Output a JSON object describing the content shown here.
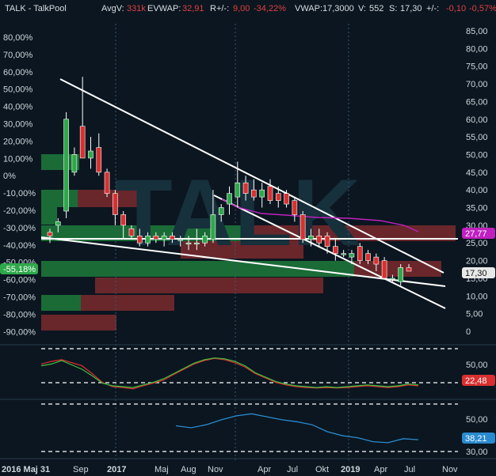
{
  "header": {
    "ticker": "TALK - TalkPool",
    "avgv_label": "AvgV:",
    "avgv_value": "331k",
    "evwap_label": "EVWAP:",
    "evwap_value": "32,91",
    "rplus_label": "R+/-:",
    "rplus_value": "9,00",
    "rpct_value": "-34,22%",
    "vwap_label": "VWAP:",
    "vwap_value": "17,3000",
    "v_label": "V:",
    "v_value": "552",
    "s_label": "S:",
    "s_value": "17,30",
    "pm_label": "+/-:",
    "pm_value": "-0,10",
    "pm_pct": "-0,57%"
  },
  "colors": {
    "background": "#0b1620",
    "up_candle": "#2ea84a",
    "down_candle": "#d83030",
    "zone_green": "#1f7a3c",
    "zone_red": "#7a2a2e",
    "trendline": "#ffffff",
    "ma": "#c020c0",
    "osc_red": "#e03030",
    "osc_green": "#40c040",
    "osc_blue": "#2a8ad0"
  },
  "chart_data": {
    "type": "candlestick",
    "watermark": "TALK",
    "y_right_ticks": [
      "85,00",
      "80,00",
      "75,00",
      "70,00",
      "65,00",
      "60,00",
      "55,00",
      "50,00",
      "45,00",
      "40,00",
      "35,00",
      "30,00",
      "25,00",
      "20,00",
      "15,00",
      "10,00",
      "5,00",
      "0"
    ],
    "y_left_ticks": [
      "80,00%",
      "70,00%",
      "60,00%",
      "50,00%",
      "40,00%",
      "30,00%",
      "20,00%",
      "10,00%",
      "0%",
      "-10,00%",
      "-20,00%",
      "-30,00%",
      "-40,00%",
      "-50,00%",
      "-60,00%",
      "-70,00%",
      "-80,00%",
      "-90,00%"
    ],
    "x_labels": [
      "2016 Maj 31",
      "Sep",
      "2017",
      "Maj",
      "Aug",
      "Nov",
      "Apr",
      "Jul",
      "Okt",
      "2019",
      "Apr",
      "Jul",
      "Nov"
    ],
    "price_tag": "17,30",
    "ma_tag": "27,77",
    "pct_tag": "-55,18%",
    "candles": [
      {
        "o": 28,
        "h": 29,
        "l": 25,
        "c": 27
      },
      {
        "o": 30,
        "h": 32,
        "l": 28,
        "c": 31
      },
      {
        "o": 34,
        "h": 62,
        "l": 32,
        "c": 60
      },
      {
        "o": 45,
        "h": 52,
        "l": 44,
        "c": 50
      },
      {
        "o": 58,
        "h": 72,
        "l": 49,
        "c": 49
      },
      {
        "o": 49,
        "h": 55,
        "l": 46,
        "c": 51
      },
      {
        "o": 52,
        "h": 56,
        "l": 44,
        "c": 45
      },
      {
        "o": 45,
        "h": 46,
        "l": 38,
        "c": 39
      },
      {
        "o": 39,
        "h": 40,
        "l": 30,
        "c": 33
      },
      {
        "o": 33,
        "h": 34,
        "l": 26,
        "c": 30
      },
      {
        "o": 29,
        "h": 30,
        "l": 26,
        "c": 27
      },
      {
        "o": 27,
        "h": 29,
        "l": 24,
        "c": 25
      },
      {
        "o": 25,
        "h": 28,
        "l": 24,
        "c": 27
      },
      {
        "o": 27,
        "h": 28,
        "l": 25,
        "c": 26
      },
      {
        "o": 26,
        "h": 28,
        "l": 24,
        "c": 27
      },
      {
        "o": 27,
        "h": 28,
        "l": 25,
        "c": 26
      },
      {
        "o": 26,
        "h": 27,
        "l": 24,
        "c": 26
      },
      {
        "o": 25,
        "h": 27,
        "l": 23,
        "c": 25
      },
      {
        "o": 25,
        "h": 29,
        "l": 23,
        "c": 25
      },
      {
        "o": 25,
        "h": 28,
        "l": 24,
        "c": 27
      },
      {
        "o": 26,
        "h": 40,
        "l": 25,
        "c": 33
      },
      {
        "o": 33,
        "h": 36,
        "l": 31,
        "c": 35
      },
      {
        "o": 36,
        "h": 41,
        "l": 33,
        "c": 39
      },
      {
        "o": 38,
        "h": 48,
        "l": 35,
        "c": 42
      },
      {
        "o": 42,
        "h": 44,
        "l": 37,
        "c": 39
      },
      {
        "o": 40,
        "h": 43,
        "l": 37,
        "c": 38
      },
      {
        "o": 38,
        "h": 42,
        "l": 35,
        "c": 40
      },
      {
        "o": 41,
        "h": 43,
        "l": 36,
        "c": 37
      },
      {
        "o": 39,
        "h": 41,
        "l": 35,
        "c": 37
      },
      {
        "o": 39,
        "h": 40,
        "l": 35,
        "c": 36
      },
      {
        "o": 37,
        "h": 38,
        "l": 31,
        "c": 33
      },
      {
        "o": 33,
        "h": 34,
        "l": 25,
        "c": 26
      },
      {
        "o": 26,
        "h": 29,
        "l": 24,
        "c": 27
      },
      {
        "o": 27,
        "h": 29,
        "l": 24,
        "c": 25
      },
      {
        "o": 27,
        "h": 28,
        "l": 22,
        "c": 24
      },
      {
        "o": 24,
        "h": 26,
        "l": 20,
        "c": 22
      },
      {
        "o": 22,
        "h": 23,
        "l": 21,
        "c": 22
      },
      {
        "o": 21,
        "h": 23,
        "l": 19,
        "c": 22
      },
      {
        "o": 24,
        "h": 25,
        "l": 19,
        "c": 20
      },
      {
        "o": 22,
        "h": 23,
        "l": 19,
        "c": 20
      },
      {
        "o": 21,
        "h": 22,
        "l": 17,
        "c": 19
      },
      {
        "o": 20,
        "h": 21,
        "l": 15,
        "c": 15
      },
      {
        "o": 15,
        "h": 16,
        "l": 14,
        "c": 15
      },
      {
        "o": 14,
        "h": 19,
        "l": 13,
        "c": 18
      },
      {
        "o": 18,
        "h": 19,
        "l": 17,
        "c": 17
      }
    ],
    "osc1": {
      "ticks": [
        "50,00"
      ],
      "tag": "22,48",
      "red": [
        72,
        78,
        82,
        75,
        68,
        50,
        30,
        20,
        18,
        15,
        22,
        28,
        35,
        48,
        60,
        72,
        80,
        85,
        82,
        75,
        65,
        50,
        40,
        30,
        24,
        20,
        18,
        17,
        18,
        17,
        18,
        20,
        22,
        20,
        18,
        20,
        24,
        22
      ],
      "green": [
        68,
        72,
        80,
        70,
        60,
        45,
        28,
        22,
        20,
        18,
        24,
        30,
        38,
        50,
        62,
        74,
        82,
        86,
        84,
        78,
        68,
        52,
        42,
        32,
        26,
        22,
        20,
        18,
        20,
        18,
        20,
        22,
        24,
        22,
        20,
        22,
        26,
        24
      ]
    },
    "osc2": {
      "ticks": [
        "50,00",
        "30,00"
      ],
      "tag": "38,21",
      "blue": [
        54,
        52,
        55,
        60,
        64,
        66,
        63,
        60,
        58,
        55,
        48,
        44,
        42,
        38,
        37,
        41,
        40
      ]
    }
  }
}
